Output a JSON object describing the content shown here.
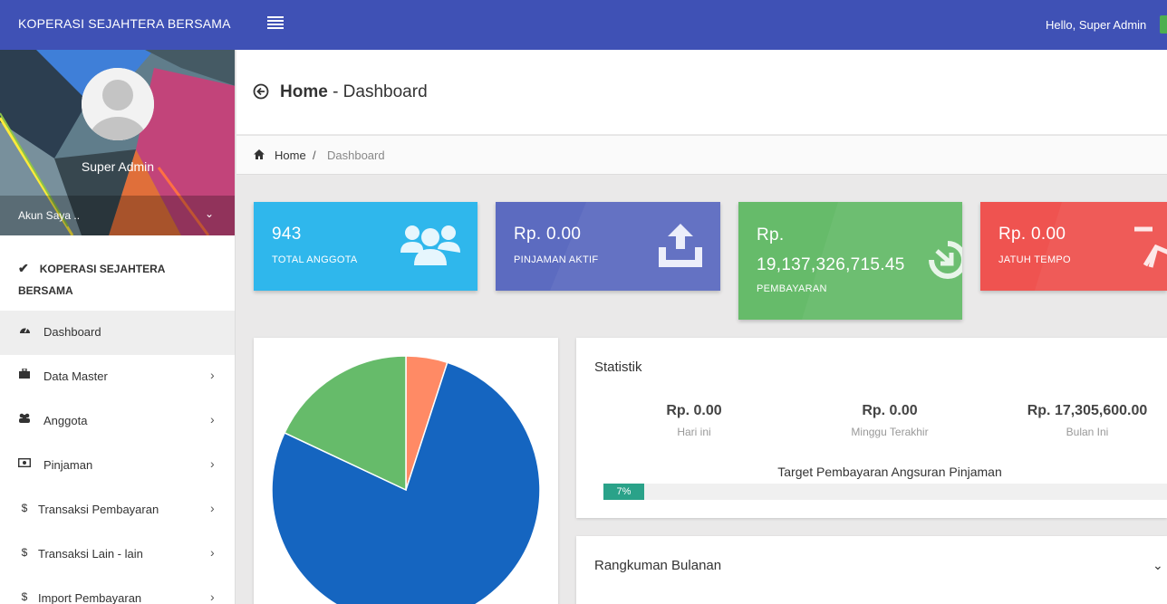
{
  "app": {
    "brand": "KOPERASI SEJAHTERA BERSAMA",
    "greeting": "Hello, Super Admin"
  },
  "sidebar": {
    "username": "Super Admin",
    "account_label": "Akun Saya ..",
    "section_title": "KOPERASI SEJAHTERA BERSAMA",
    "items": [
      {
        "label": "Dashboard",
        "icon": "dashboard-icon",
        "active": true
      },
      {
        "label": "Data Master",
        "icon": "briefcase-icon"
      },
      {
        "label": "Anggota",
        "icon": "users-icon"
      },
      {
        "label": "Pinjaman",
        "icon": "money-icon"
      },
      {
        "label": "Transaksi Pembayaran",
        "icon": "dollar-icon"
      },
      {
        "label": "Transaksi Lain - lain",
        "icon": "dollar-icon"
      },
      {
        "label": "Import Pembayaran",
        "icon": "dollar-icon"
      }
    ]
  },
  "header": {
    "title_bold": "Home",
    "title_rest": " - Dashboard"
  },
  "breadcrumb": {
    "home": "Home",
    "separator": "/",
    "current": "Dashboard"
  },
  "info_boxes": [
    {
      "value": "943",
      "caption": "TOTAL ANGGOTA",
      "color": "#2fb7ec",
      "icon": "group-icon"
    },
    {
      "value": "Rp. 0.00",
      "caption": "PINJAMAN AKTIF",
      "color": "#5c6bc0",
      "icon": "upload-tray-icon"
    },
    {
      "value": "Rp. 19,137,326,715.45",
      "caption": "PEMBAYARAN",
      "color": "#66bb6a",
      "icon": "refresh-arrow-icon"
    },
    {
      "value": "Rp. 0.00",
      "caption": "JATUH TEMPO",
      "color": "#ef5350",
      "icon": "pen-nib-icon"
    }
  ],
  "statistik": {
    "title": "Statistik",
    "stats": [
      {
        "value": "Rp. 0.00",
        "label": "Hari ini"
      },
      {
        "value": "Rp. 0.00",
        "label": "Minggu Terakhir"
      },
      {
        "value": "Rp. 17,305,600.00",
        "label": "Bulan Ini"
      }
    ],
    "target_label": "Target Pembayaran Angsuran Pinjaman",
    "progress_percent": 7,
    "progress_text": "7%"
  },
  "rangkuman": {
    "title": "Rangkuman Bulanan"
  },
  "chart_data": {
    "type": "pie",
    "values": [
      77,
      18,
      5
    ],
    "colors": [
      "#1565c0",
      "#66bb6a",
      "#ff8a65"
    ]
  }
}
